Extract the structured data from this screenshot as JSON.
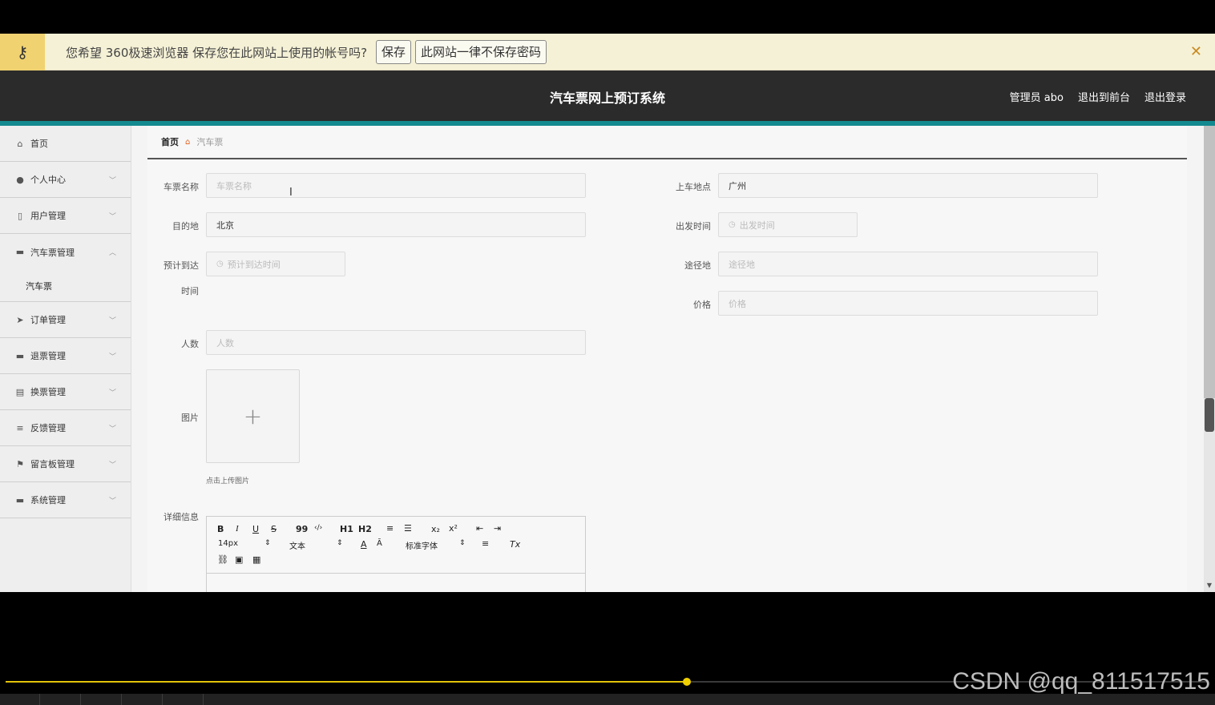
{
  "password_bar": {
    "message": "您希望 360极速浏览器 保存您在此网站上使用的帐号吗?",
    "save_button": "保存",
    "never_button": "此网站一律不保存密码",
    "close_icon": "close-icon",
    "key_icon": "key-icon"
  },
  "header": {
    "title": "汽车票网上预订系统",
    "admin_label": "管理员 abo",
    "to_front": "退出到前台",
    "logout": "退出登录"
  },
  "sidebar": {
    "items": [
      {
        "label": "首页",
        "icon": "home-icon",
        "glyph": "⌂"
      },
      {
        "label": "个人中心",
        "icon": "user-icon",
        "glyph": "●"
      },
      {
        "label": "用户管理",
        "icon": "mobile-icon",
        "glyph": "▯"
      },
      {
        "label": "汽车票管理",
        "icon": "ticket-icon",
        "glyph": "▬"
      },
      {
        "label": "订单管理",
        "icon": "send-icon",
        "glyph": "➤"
      },
      {
        "label": "退票管理",
        "icon": "monitor-icon",
        "glyph": "▬"
      },
      {
        "label": "换票管理",
        "icon": "clipboard-icon",
        "glyph": "▤"
      },
      {
        "label": "反馈管理",
        "icon": "sliders-icon",
        "glyph": "≡"
      },
      {
        "label": "留言板管理",
        "icon": "flag-icon",
        "glyph": "⚑"
      },
      {
        "label": "系统管理",
        "icon": "briefcase-icon",
        "glyph": "▬"
      }
    ],
    "submenu_item": "汽车票"
  },
  "breadcrumb": {
    "home": "首页",
    "current": "汽车票"
  },
  "form": {
    "ticket_name": {
      "label": "车票名称",
      "placeholder": "车票名称",
      "value": ""
    },
    "departure": {
      "label": "上车地点",
      "value": "广州"
    },
    "destination": {
      "label": "目的地",
      "value": "北京"
    },
    "depart_time": {
      "label": "出发时间",
      "placeholder": "出发时间"
    },
    "arrival_label_1": "预计到达",
    "arrival_label_2": "时间",
    "arrival": {
      "placeholder": "预计到达时间"
    },
    "via": {
      "label": "途径地",
      "placeholder": "途径地"
    },
    "price": {
      "label": "价格",
      "placeholder": "价格"
    },
    "people": {
      "label": "人数",
      "placeholder": "人数"
    },
    "image": {
      "label": "图片",
      "note": "点击上传图片"
    },
    "detail": {
      "label": "详细信息"
    }
  },
  "editor": {
    "row1": [
      "B",
      "I",
      "U",
      "S",
      "99",
      "‹/›",
      "H1",
      "H2",
      "≡",
      "☰",
      "x₂",
      "x²",
      "⇤",
      "⇥"
    ],
    "font_size": "14px",
    "format": "文本",
    "font_family": "标准字体"
  },
  "watermark": "CSDN @qq_811517515",
  "player": {
    "progress": 0.567
  }
}
